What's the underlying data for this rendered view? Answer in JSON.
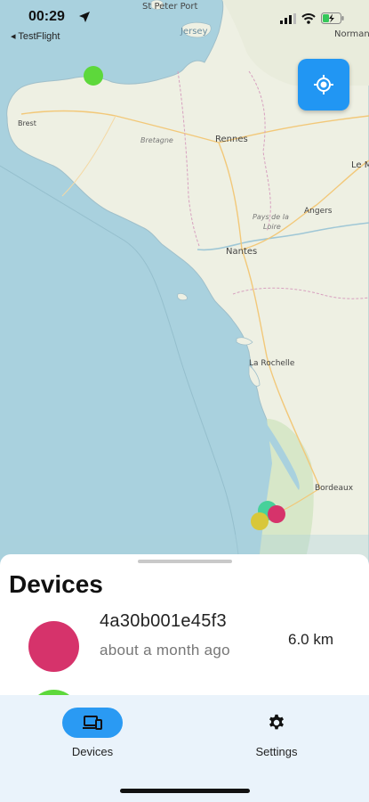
{
  "status_bar": {
    "time": "00:29",
    "back_app": "◂ TestFlight"
  },
  "map": {
    "labels": {
      "st_peter_port": "St Peter Port",
      "jersey": "Jersey",
      "brest": "Brest",
      "bretagne": "Bretagne",
      "rennes": "Rennes",
      "le_m": "Le M",
      "pays_de_la_loire_1": "Pays de la",
      "pays_de_la_loire_2": "Loire",
      "angers": "Angers",
      "nantes": "Nantes",
      "la_rochelle": "La Rochelle",
      "bordeaux": "Bordeaux",
      "normandie": "Normand"
    },
    "colors": {
      "sea": "#a9d1de",
      "land": "#eef0e3",
      "marker_green": "#5dd83b",
      "marker_teal": "#47d19a",
      "marker_magenta": "#d6336b",
      "marker_yellow": "#d8c73a"
    }
  },
  "locate_button": {
    "icon": "my-location-icon",
    "color": "#2196f3"
  },
  "sheet": {
    "title": "Devices",
    "devices": [
      {
        "id": "4a30b001e45f3",
        "last_seen": "about a month ago",
        "distance": "6.0 km",
        "color": "#d6336b"
      },
      {
        "id": "",
        "last_seen": "",
        "distance": "",
        "color": "#5dd83b"
      }
    ]
  },
  "nav": {
    "items": [
      {
        "label": "Devices",
        "icon": "devices-icon",
        "active": true
      },
      {
        "label": "Settings",
        "icon": "gear-icon",
        "active": false
      }
    ],
    "accent": "#2a9af3"
  }
}
